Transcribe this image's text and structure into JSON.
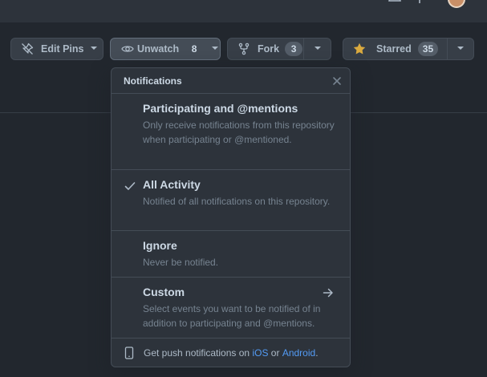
{
  "repo_actions": {
    "edit_pins_label": "Edit Pins",
    "unwatch_label": "Unwatch",
    "watch_count": "8",
    "fork_label": "Fork",
    "fork_count": "3",
    "starred_label": "Starred",
    "star_count": "35"
  },
  "notifications_menu": {
    "title": "Notifications",
    "options": [
      {
        "title": "Participating and @mentions",
        "description": "Only receive notifications from this repository when participating or @mentioned.",
        "selected": false
      },
      {
        "title": "All Activity",
        "description": "Notified of all notifications on this repository.",
        "selected": true
      },
      {
        "title": "Ignore",
        "description": "Never be notified.",
        "selected": false
      },
      {
        "title": "Custom",
        "description": "Select events you want to be notified of in addition to participating and @mentions.",
        "selected": false
      }
    ],
    "footer": {
      "prefix": "Get push notifications on",
      "ios_link": "iOS",
      "conjunction": "or",
      "android_link": "Android",
      "suffix": "."
    }
  },
  "colors": {
    "background": "#22272e",
    "menu_background": "#2d333b",
    "border": "#444c56",
    "link": "#539bf5",
    "star": "#daaa3f"
  },
  "icons": [
    "bell-icon",
    "plus-icon",
    "avatar",
    "pin-off-icon",
    "eye-icon",
    "fork-icon",
    "star-icon",
    "caret-down-icon",
    "close-icon",
    "check-icon",
    "arrow-right-icon",
    "device-mobile-icon"
  ]
}
